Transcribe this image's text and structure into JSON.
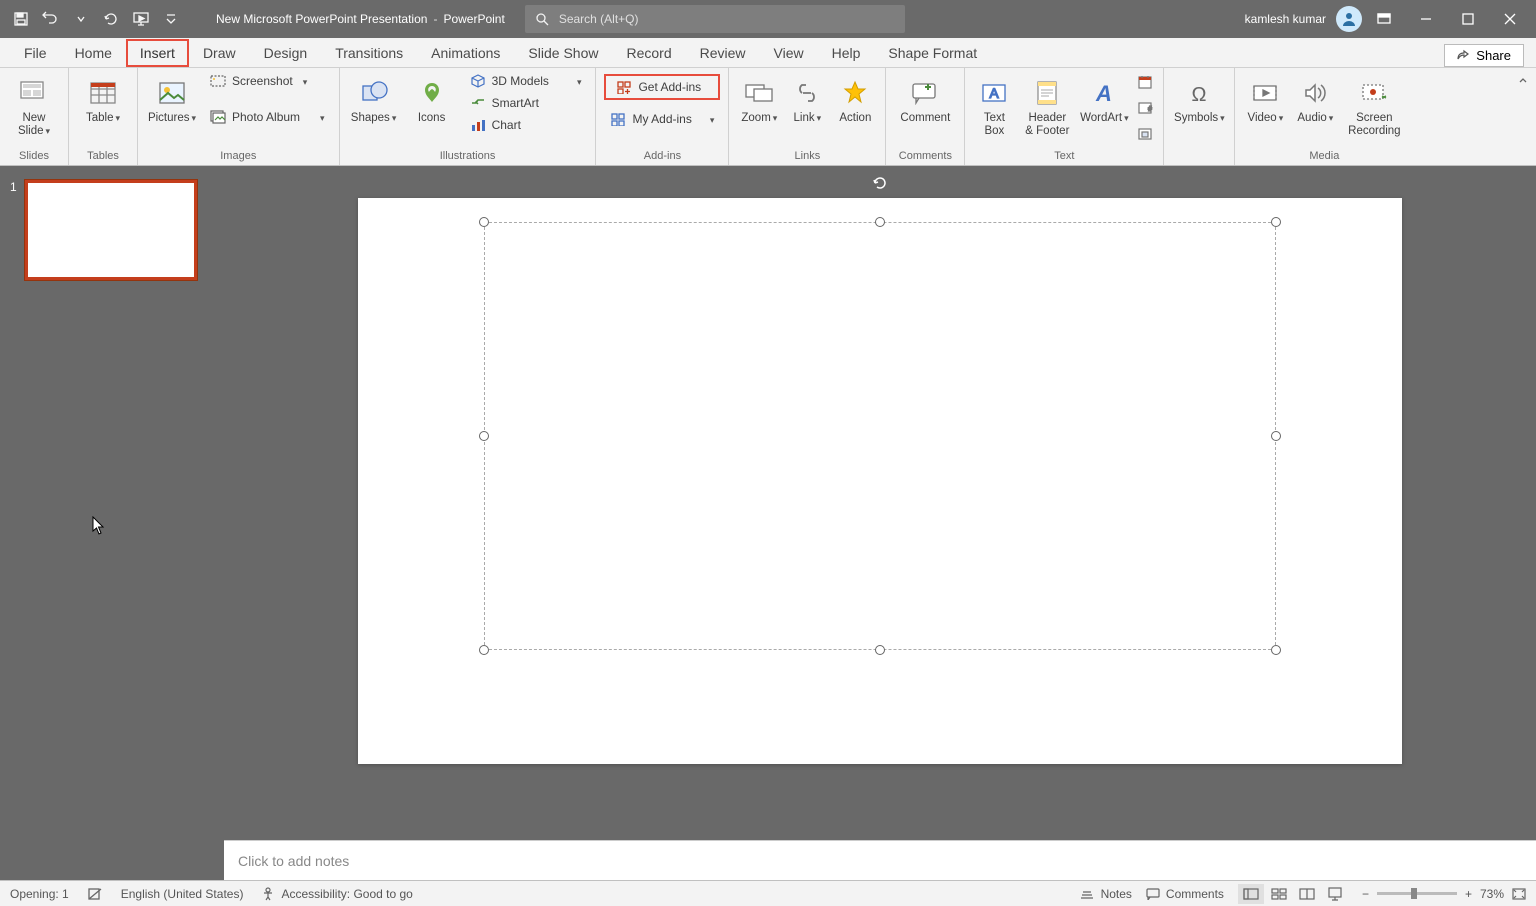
{
  "titlebar": {
    "document": "New Microsoft PowerPoint Presentation",
    "app": "PowerPoint",
    "sep": "-",
    "search_placeholder": "Search (Alt+Q)",
    "user": "kamlesh kumar"
  },
  "tabs": {
    "file": "File",
    "home": "Home",
    "insert": "Insert",
    "draw": "Draw",
    "design": "Design",
    "transitions": "Transitions",
    "animations": "Animations",
    "slideshow": "Slide Show",
    "record": "Record",
    "review": "Review",
    "view": "View",
    "help": "Help",
    "shape_format": "Shape Format",
    "share": "Share"
  },
  "ribbon": {
    "groups": {
      "slides": {
        "new_slide": "New\nSlide",
        "label": "Slides"
      },
      "tables": {
        "table": "Table",
        "label": "Tables"
      },
      "images": {
        "pictures": "Pictures",
        "screenshot": "Screenshot",
        "photo_album": "Photo Album",
        "label": "Images"
      },
      "illustrations": {
        "shapes": "Shapes",
        "icons": "Icons",
        "models": "3D Models",
        "smartart": "SmartArt",
        "chart": "Chart",
        "label": "Illustrations"
      },
      "addins": {
        "get": "Get Add-ins",
        "my": "My Add-ins",
        "label": "Add-ins"
      },
      "links": {
        "zoom": "Zoom",
        "link": "Link",
        "action": "Action",
        "label": "Links"
      },
      "comments": {
        "comment": "Comment",
        "label": "Comments"
      },
      "text": {
        "textbox": "Text\nBox",
        "header": "Header\n& Footer",
        "wordart": "WordArt",
        "label": "Text"
      },
      "symbols": {
        "symbols": "Symbols"
      },
      "media": {
        "video": "Video",
        "audio": "Audio",
        "screen": "Screen\nRecording",
        "label": "Media"
      }
    }
  },
  "thumbs": {
    "slide1_num": "1"
  },
  "notes": {
    "placeholder": "Click to add notes"
  },
  "status": {
    "opening": "Opening:  1",
    "lang": "English (United States)",
    "accessibility": "Accessibility: Good to go",
    "notes": "Notes",
    "comments": "Comments",
    "zoom": "73%"
  }
}
